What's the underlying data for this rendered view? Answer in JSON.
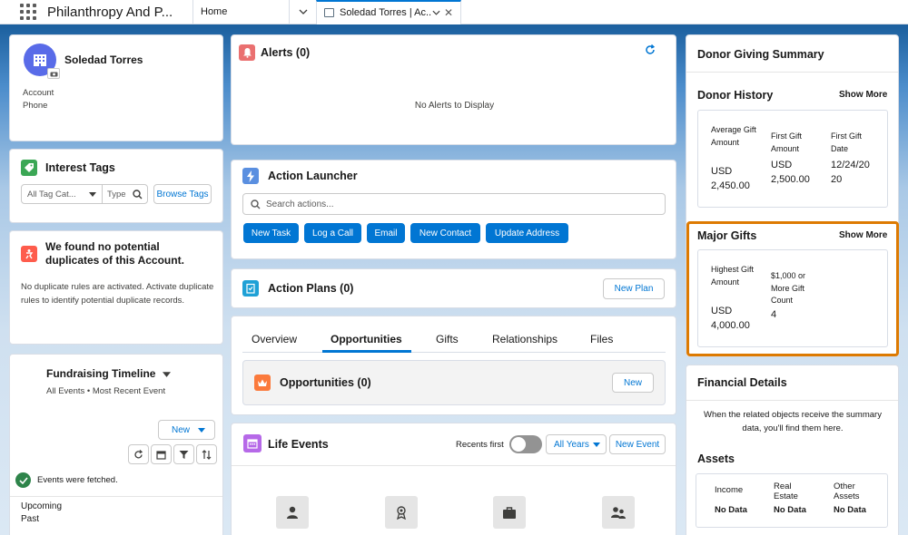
{
  "app": {
    "name": "Philanthropy And P..."
  },
  "tabs": {
    "home": "Home",
    "record": "Soledad Torres | Ac..."
  },
  "account": {
    "name": "Soledad Torres",
    "label_account": "Account",
    "label_phone": "Phone"
  },
  "interest_tags": {
    "title": "Interest Tags",
    "category_placeholder": "All Tag Cat...",
    "type_placeholder": "Type",
    "browse_label": "Browse Tags"
  },
  "duplicates": {
    "title": "We found no potential duplicates of this Account.",
    "body": "No duplicate rules are activated. Activate duplicate rules to identify potential duplicate records."
  },
  "timeline": {
    "title": "Fundraising Timeline",
    "subtitle": "All Events • Most Recent Event",
    "new_label": "New",
    "fetched": "Events were fetched.",
    "upcoming": "Upcoming",
    "past": "Past"
  },
  "alerts": {
    "title": "Alerts (0)",
    "empty": "No Alerts to Display"
  },
  "action_launcher": {
    "title": "Action Launcher",
    "search_placeholder": "Search actions...",
    "buttons": [
      "New Task",
      "Log a Call",
      "Email",
      "New Contact",
      "Update Address"
    ]
  },
  "action_plans": {
    "title": "Action Plans (0)",
    "new_plan": "New Plan"
  },
  "record_tabs": {
    "items": [
      "Overview",
      "Opportunities",
      "Gifts",
      "Relationships",
      "Files"
    ],
    "active": "Opportunities"
  },
  "opportunities": {
    "title": "Opportunities (0)",
    "new_label": "New"
  },
  "life_events": {
    "title": "Life Events",
    "recents_first": "Recents first",
    "years": "All Years",
    "new_event": "New Event"
  },
  "donor_summary": {
    "title": "Donor Giving Summary"
  },
  "donor_history": {
    "title": "Donor History",
    "show_more": "Show More",
    "col1_label": "Average Gift Amount",
    "col1_value": "USD 2,450.00",
    "col2_label": "First Gift Amount",
    "col2_value": "USD 2,500.00",
    "col3_label": "First Gift Date",
    "col3_value": "12/24/20 20"
  },
  "major_gifts": {
    "title": "Major Gifts",
    "show_more": "Show More",
    "col1_label": "Highest Gift Amount",
    "col1_value": "USD 4,000.00",
    "col2_label": "$1,000 or More Gift Count",
    "col2_value": "4"
  },
  "financial": {
    "title": "Financial Details",
    "body": "When the related objects receive the summary data, you'll find them here."
  },
  "assets": {
    "title": "Assets",
    "cols": [
      {
        "label": "Income",
        "value": "No Data"
      },
      {
        "label": "Real Estate",
        "value": "No Data"
      },
      {
        "label": "Other Assets",
        "value": "No Data"
      }
    ]
  },
  "colors": {
    "brand": "#0176d3",
    "highlight": "#dd7a01"
  }
}
